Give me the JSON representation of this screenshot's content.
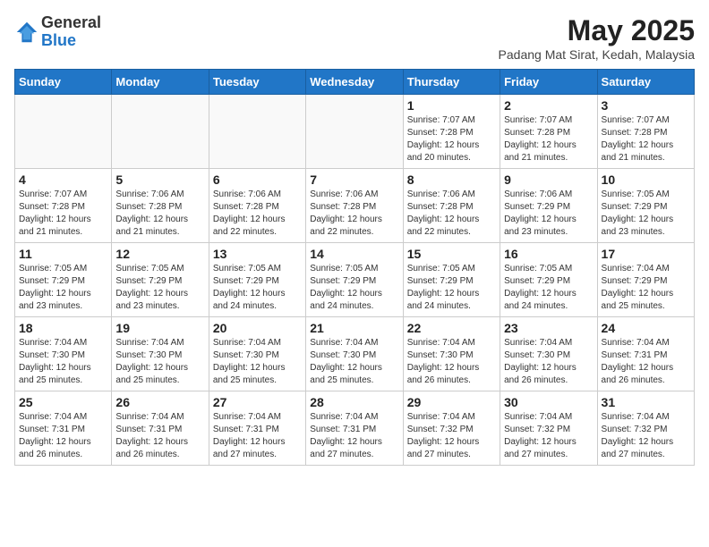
{
  "header": {
    "logo_general": "General",
    "logo_blue": "Blue",
    "month_year": "May 2025",
    "location": "Padang Mat Sirat, Kedah, Malaysia"
  },
  "days_of_week": [
    "Sunday",
    "Monday",
    "Tuesday",
    "Wednesday",
    "Thursday",
    "Friday",
    "Saturday"
  ],
  "weeks": [
    [
      {
        "day": "",
        "info": ""
      },
      {
        "day": "",
        "info": ""
      },
      {
        "day": "",
        "info": ""
      },
      {
        "day": "",
        "info": ""
      },
      {
        "day": "1",
        "info": "Sunrise: 7:07 AM\nSunset: 7:28 PM\nDaylight: 12 hours and 20 minutes."
      },
      {
        "day": "2",
        "info": "Sunrise: 7:07 AM\nSunset: 7:28 PM\nDaylight: 12 hours and 21 minutes."
      },
      {
        "day": "3",
        "info": "Sunrise: 7:07 AM\nSunset: 7:28 PM\nDaylight: 12 hours and 21 minutes."
      }
    ],
    [
      {
        "day": "4",
        "info": "Sunrise: 7:07 AM\nSunset: 7:28 PM\nDaylight: 12 hours and 21 minutes."
      },
      {
        "day": "5",
        "info": "Sunrise: 7:06 AM\nSunset: 7:28 PM\nDaylight: 12 hours and 21 minutes."
      },
      {
        "day": "6",
        "info": "Sunrise: 7:06 AM\nSunset: 7:28 PM\nDaylight: 12 hours and 22 minutes."
      },
      {
        "day": "7",
        "info": "Sunrise: 7:06 AM\nSunset: 7:28 PM\nDaylight: 12 hours and 22 minutes."
      },
      {
        "day": "8",
        "info": "Sunrise: 7:06 AM\nSunset: 7:28 PM\nDaylight: 12 hours and 22 minutes."
      },
      {
        "day": "9",
        "info": "Sunrise: 7:06 AM\nSunset: 7:29 PM\nDaylight: 12 hours and 23 minutes."
      },
      {
        "day": "10",
        "info": "Sunrise: 7:05 AM\nSunset: 7:29 PM\nDaylight: 12 hours and 23 minutes."
      }
    ],
    [
      {
        "day": "11",
        "info": "Sunrise: 7:05 AM\nSunset: 7:29 PM\nDaylight: 12 hours and 23 minutes."
      },
      {
        "day": "12",
        "info": "Sunrise: 7:05 AM\nSunset: 7:29 PM\nDaylight: 12 hours and 23 minutes."
      },
      {
        "day": "13",
        "info": "Sunrise: 7:05 AM\nSunset: 7:29 PM\nDaylight: 12 hours and 24 minutes."
      },
      {
        "day": "14",
        "info": "Sunrise: 7:05 AM\nSunset: 7:29 PM\nDaylight: 12 hours and 24 minutes."
      },
      {
        "day": "15",
        "info": "Sunrise: 7:05 AM\nSunset: 7:29 PM\nDaylight: 12 hours and 24 minutes."
      },
      {
        "day": "16",
        "info": "Sunrise: 7:05 AM\nSunset: 7:29 PM\nDaylight: 12 hours and 24 minutes."
      },
      {
        "day": "17",
        "info": "Sunrise: 7:04 AM\nSunset: 7:29 PM\nDaylight: 12 hours and 25 minutes."
      }
    ],
    [
      {
        "day": "18",
        "info": "Sunrise: 7:04 AM\nSunset: 7:30 PM\nDaylight: 12 hours and 25 minutes."
      },
      {
        "day": "19",
        "info": "Sunrise: 7:04 AM\nSunset: 7:30 PM\nDaylight: 12 hours and 25 minutes."
      },
      {
        "day": "20",
        "info": "Sunrise: 7:04 AM\nSunset: 7:30 PM\nDaylight: 12 hours and 25 minutes."
      },
      {
        "day": "21",
        "info": "Sunrise: 7:04 AM\nSunset: 7:30 PM\nDaylight: 12 hours and 25 minutes."
      },
      {
        "day": "22",
        "info": "Sunrise: 7:04 AM\nSunset: 7:30 PM\nDaylight: 12 hours and 26 minutes."
      },
      {
        "day": "23",
        "info": "Sunrise: 7:04 AM\nSunset: 7:30 PM\nDaylight: 12 hours and 26 minutes."
      },
      {
        "day": "24",
        "info": "Sunrise: 7:04 AM\nSunset: 7:31 PM\nDaylight: 12 hours and 26 minutes."
      }
    ],
    [
      {
        "day": "25",
        "info": "Sunrise: 7:04 AM\nSunset: 7:31 PM\nDaylight: 12 hours and 26 minutes."
      },
      {
        "day": "26",
        "info": "Sunrise: 7:04 AM\nSunset: 7:31 PM\nDaylight: 12 hours and 26 minutes."
      },
      {
        "day": "27",
        "info": "Sunrise: 7:04 AM\nSunset: 7:31 PM\nDaylight: 12 hours and 27 minutes."
      },
      {
        "day": "28",
        "info": "Sunrise: 7:04 AM\nSunset: 7:31 PM\nDaylight: 12 hours and 27 minutes."
      },
      {
        "day": "29",
        "info": "Sunrise: 7:04 AM\nSunset: 7:32 PM\nDaylight: 12 hours and 27 minutes."
      },
      {
        "day": "30",
        "info": "Sunrise: 7:04 AM\nSunset: 7:32 PM\nDaylight: 12 hours and 27 minutes."
      },
      {
        "day": "31",
        "info": "Sunrise: 7:04 AM\nSunset: 7:32 PM\nDaylight: 12 hours and 27 minutes."
      }
    ]
  ]
}
